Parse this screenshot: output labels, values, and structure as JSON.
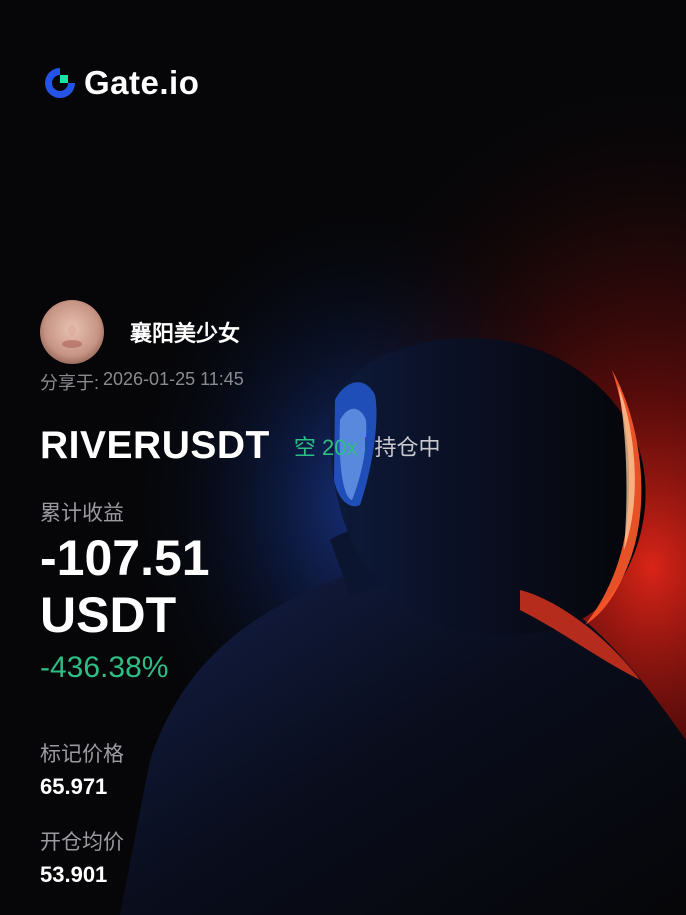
{
  "brand": {
    "name": "Gate.io",
    "accent": "#2354e6",
    "accent_green": "#17e5a1"
  },
  "user": {
    "name": "襄阳美少女",
    "share_label": "分享于:",
    "share_time": "2026-01-25 11:45"
  },
  "position": {
    "pair": "RIVERUSDT",
    "side": "空 20x",
    "status": "持仓中"
  },
  "pnl": {
    "label": "累计收益",
    "amount": "-107.51",
    "unit": "USDT",
    "rate": "-436.38%"
  },
  "mark_price": {
    "label": "标记价格",
    "value": "65.971"
  },
  "entry_price": {
    "label": "开仓均价",
    "value": "53.901"
  },
  "colors": {
    "background": "#060608",
    "positive_green": "#2fbd85",
    "muted_text": "#8b8b8f"
  }
}
